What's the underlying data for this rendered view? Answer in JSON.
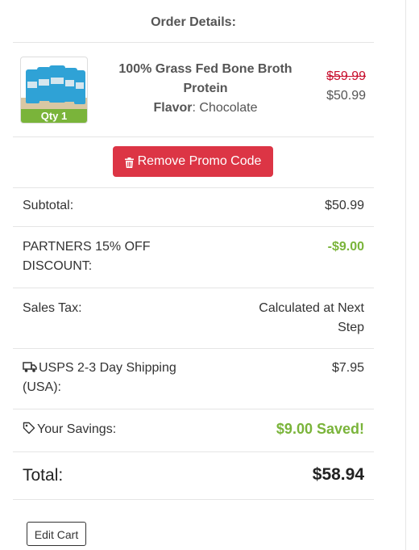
{
  "order": {
    "title": "Order Details:",
    "item": {
      "name": "100% Grass Fed Bone Broth Protein",
      "flavor_label": "Flavor",
      "flavor_value": "Chocolate",
      "qty_label": "Qty 1",
      "original_price": "$59.99",
      "price": "$50.99",
      "image_icon": "product-bags-image"
    },
    "promo_button_label": "Remove Promo Code",
    "subtotal": {
      "label": "Subtotal:",
      "value": "$50.99"
    },
    "discount": {
      "label": "PARTNERS 15% OFF DISCOUNT:",
      "value": "-$9.00"
    },
    "sales_tax": {
      "label": "Sales Tax:",
      "value": "Calculated at Next Step"
    },
    "shipping": {
      "label": "USPS 2-3 Day Shipping (USA):",
      "value": "$7.95",
      "icon": "truck-icon"
    },
    "savings": {
      "label": "Your Savings:",
      "value": "$9.00 Saved!",
      "icon": "tag-icon"
    },
    "total": {
      "label": "Total:",
      "value": "$58.94"
    },
    "edit_cart_label": "Edit Cart"
  },
  "colors": {
    "accent_green": "#7ab43a",
    "danger_red": "#dc3545",
    "strike_red": "#c8102e"
  }
}
